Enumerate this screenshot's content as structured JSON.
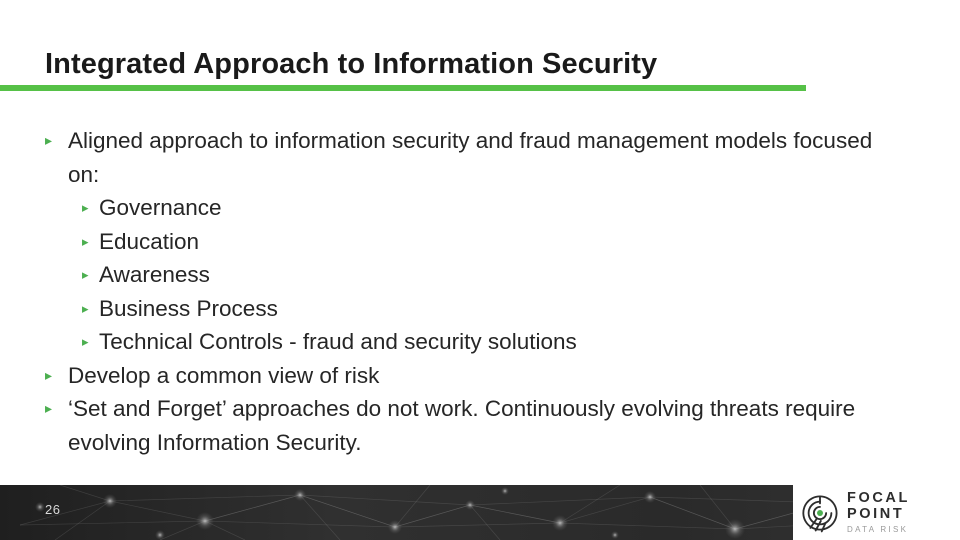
{
  "slide": {
    "title": "Integrated Approach to Information Security",
    "accent_color": "#56c147",
    "background_color": "#ffffff",
    "body_text_color": "#262626"
  },
  "bullets": [
    {
      "level": 1,
      "marker": "▸",
      "text": "Aligned approach to information security and fraud management models focused on:"
    },
    {
      "level": 2,
      "marker": "▸",
      "text": "Governance"
    },
    {
      "level": 2,
      "marker": "▸",
      "text": "Education"
    },
    {
      "level": 2,
      "marker": "▸",
      "text": "Awareness"
    },
    {
      "level": 2,
      "marker": "▸",
      "text": "Business Process"
    },
    {
      "level": 2,
      "marker": "▸",
      "text": "Technical Controls - fraud and security solutions"
    },
    {
      "level": 1,
      "marker": "▸",
      "text": "Develop a common view of risk"
    },
    {
      "level": 1,
      "marker": "▸",
      "text": "‘Set and Forget’ approaches do not work. Continuously evolving threats require evolving Information Security."
    }
  ],
  "footer": {
    "page_number": "26",
    "background_color": "#2b2b2b",
    "page_number_color": "#d8d8d8"
  },
  "logo": {
    "name": "FOCAL POINT",
    "tagline": "DATA RISK",
    "mark_icon": "focal-point-target-icon",
    "mark_accent_color": "#4caf50",
    "mark_color": "#2d2d2d"
  }
}
